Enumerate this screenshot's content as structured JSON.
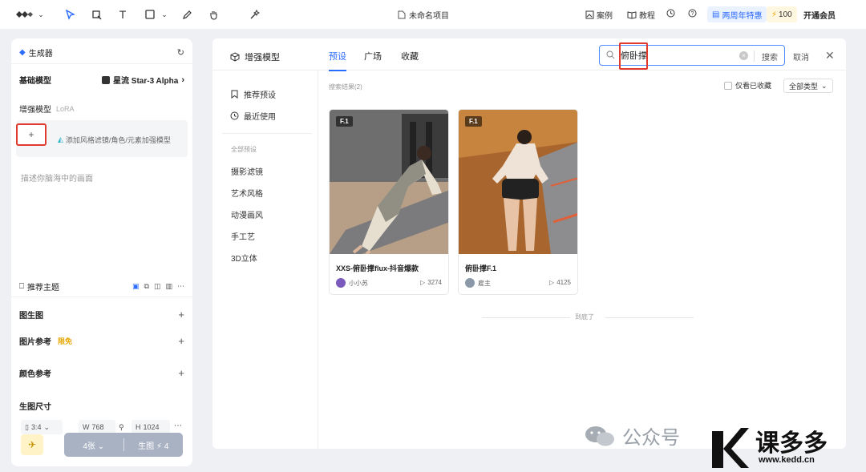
{
  "topbar": {
    "project_title": "未命名项目",
    "cases_label": "案例",
    "tutorial_label": "教程",
    "promo_label": "两周年特惠",
    "points": "100",
    "vip_label": "开通会员"
  },
  "generator": {
    "title": "生成器",
    "base_model_label": "基础模型",
    "base_model_value": "星流 Star-3 Alpha",
    "enhance_label": "增强模型",
    "enhance_sub": "LoRA",
    "add_symbol": "+",
    "lora_hint": "添加风格滤镜/角色/元素加强模型",
    "prompt_placeholder": "描述你脑海中的画面",
    "recommend_theme": "推荐主题",
    "img2img": "图生图",
    "img_ref": "图片参考",
    "img_ref_badge": "限免",
    "color_ref": "颜色参考",
    "size_label": "生图尺寸",
    "ratio": "3:4",
    "width_label": "W",
    "width": "768",
    "height_label": "H",
    "height": "1024",
    "count": "4张",
    "generate": "生图",
    "cost": "4"
  },
  "modal": {
    "title": "增强模型",
    "tabs": [
      "预设",
      "广场",
      "收藏"
    ],
    "active_tab": 0,
    "search_value": "俯卧撑",
    "search_button": "搜索",
    "cancel": "取消",
    "side_items": [
      "推荐预设",
      "最近使用"
    ],
    "group_label": "全部预设",
    "categories": [
      "摄影滤镜",
      "艺术风格",
      "动漫画风",
      "手工艺",
      "3D立体"
    ],
    "results_label": "搜索结果(2)",
    "fav_only": "仅看已收藏",
    "type_filter": "全部类型",
    "cards": [
      {
        "tag": "F.1",
        "title": "XXS-俯卧撑flux-抖音爆款",
        "author": "小小苏",
        "plays": "3274"
      },
      {
        "tag": "F.1",
        "title": "俯卧撑F.1",
        "author": "雇主",
        "plays": "4125"
      }
    ],
    "end_text": "到底了"
  },
  "watermark": {
    "wechat_text": "公众号",
    "brand": "课多多",
    "site": "www.kedd.cn"
  },
  "colors": {
    "accent": "#2c6bff",
    "highlight_box": "#e03a2f"
  }
}
